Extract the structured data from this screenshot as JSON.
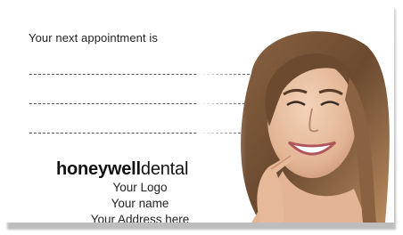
{
  "card": {
    "heading": "Your next appointment is",
    "brand_bold": "honeywell",
    "brand_light": "dental",
    "logo_placeholder": "Your Logo",
    "name_placeholder": "Your name",
    "address_placeholder": "Your Address here"
  },
  "photo": {
    "subject": "smiling-woman-pointing-at-smile-photo"
  },
  "colors": {
    "text": "#1f1f1f",
    "dash": "#555555",
    "hair": "#6b4a30",
    "skin": "#e9c2a4"
  }
}
